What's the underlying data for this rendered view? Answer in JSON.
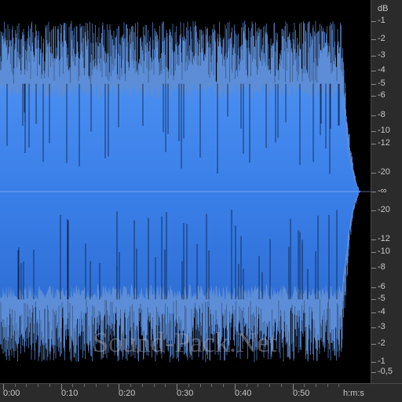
{
  "colors": {
    "background": "#000000",
    "waveform_top": "#4a8ef0",
    "waveform_bottom": "#2f6fd6",
    "waveform_line": "#6ea8ff",
    "ruler_background": "#2b2b2b",
    "ruler_text": "#c7c7c7"
  },
  "amplitude_scale": {
    "unit_label": "dB",
    "upper_labels": [
      "-1",
      "-2",
      "-3",
      "-4",
      "-5",
      "-6",
      "-8",
      "-10",
      "-12",
      "-20"
    ],
    "center_label": "-∞",
    "lower_labels": [
      "-20",
      "-12",
      "-10",
      "-8",
      "-6",
      "-5",
      "-4",
      "-3",
      "-2",
      "-1",
      "-0,5"
    ]
  },
  "time_ruler": {
    "labels": [
      "0:00",
      "0:10",
      "0:20",
      "0:30",
      "0:40",
      "0:50"
    ],
    "unit_label": "h:m:s"
  },
  "watermark": {
    "text": "Sound-Pack.Net"
  },
  "waveform": {
    "channels": "mono",
    "duration_seconds": 62,
    "fade_out_start_seconds": 58.5,
    "body_level_db": -5,
    "peak_level_db": -1
  }
}
